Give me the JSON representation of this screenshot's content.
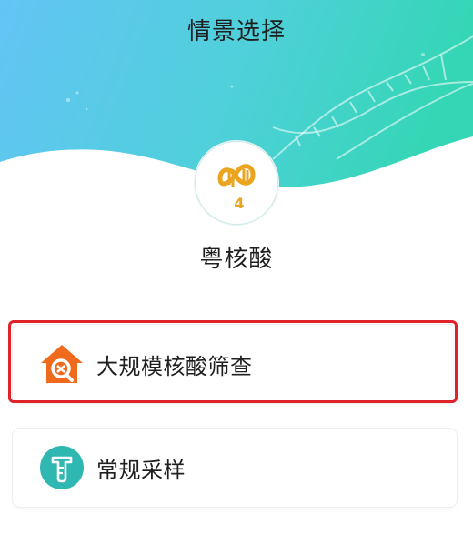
{
  "page": {
    "title": "情景选择"
  },
  "app": {
    "name": "粤核酸",
    "logo_icon": "dna-loop-icon",
    "logo_number": "4"
  },
  "options": [
    {
      "label": "大规模核酸筛查",
      "icon": "house-search-icon",
      "icon_color": "#f06a1d",
      "highlighted": true
    },
    {
      "label": "常规采样",
      "icon": "test-tube-icon",
      "icon_color": "#2fb7b2",
      "highlighted": false
    }
  ],
  "colors": {
    "header_gradient_start": "#63c4f5",
    "header_gradient_end": "#34d6b5",
    "accent_gold": "#e9a420",
    "highlight_border": "#e0232b"
  }
}
